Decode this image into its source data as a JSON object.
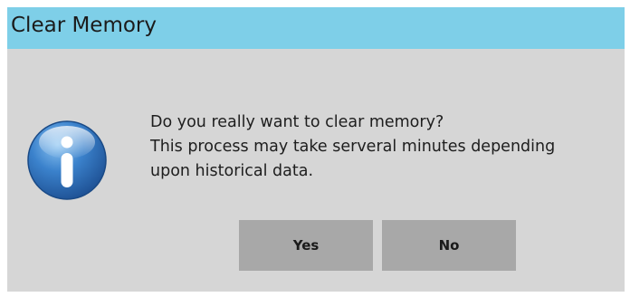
{
  "dialog": {
    "title": "Clear Memory",
    "icon": "info-icon",
    "message_lines": [
      "Do you really want to clear memory?",
      "This process may take serveral minutes depending",
      "upon historical data."
    ],
    "buttons": {
      "yes_label": "Yes",
      "no_label": "No"
    }
  },
  "colors": {
    "titlebar": "#7ecfe8",
    "body": "#d6d6d6",
    "button": "#a8a8a8",
    "icon_blue": "#2e6fb8"
  }
}
